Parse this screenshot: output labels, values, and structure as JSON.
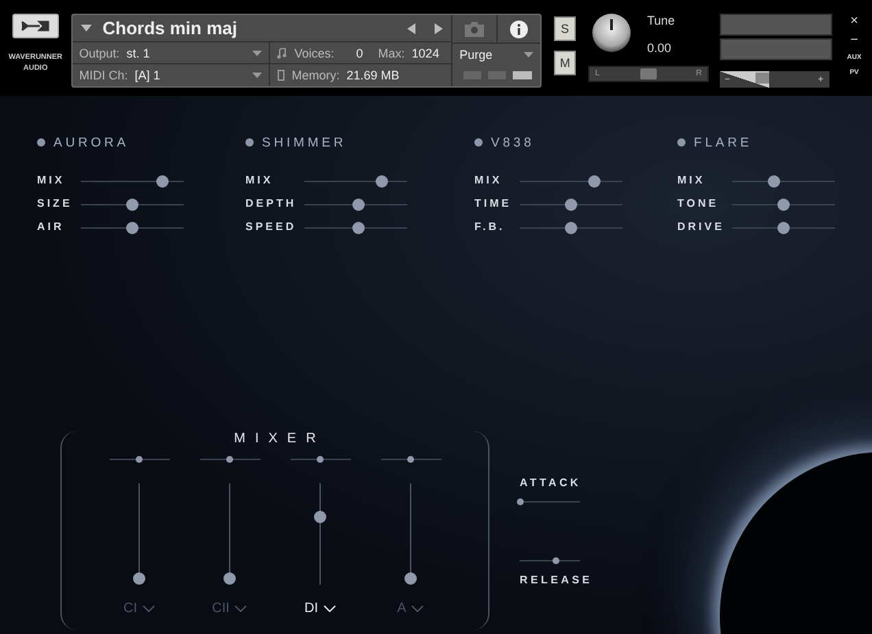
{
  "header": {
    "brand": "WAVERUNNER AUDIO",
    "instrument": {
      "name": "Chords min maj",
      "output_label": "Output:",
      "output": "st. 1",
      "midi_label": "MIDI Ch:",
      "midi": "[A] 1",
      "voices_label": "Voices:",
      "voices": "0",
      "max_label": "Max:",
      "max": "1024",
      "memory_label": "Memory:",
      "memory": "21.69 MB",
      "purge": "Purge"
    },
    "solo": "S",
    "mute": "M",
    "tune_label": "Tune",
    "tune": "0.00",
    "pan": {
      "level": 0.5
    },
    "volume": {
      "level": 0.45
    },
    "pan_left": "L",
    "pan_right": "R",
    "volume_minus": "−",
    "volume_plus": "+",
    "close": "×",
    "minimize": "−",
    "aux": "AUX",
    "pv": "PV"
  },
  "effects": [
    {
      "title": "AURORA",
      "params": [
        {
          "label": "MIX",
          "level": 0.8
        },
        {
          "label": "SIZE",
          "level": 0.5
        },
        {
          "label": "AIR",
          "level": 0.5
        }
      ]
    },
    {
      "title": "SHIMMER",
      "params": [
        {
          "label": "MIX",
          "level": 0.75
        },
        {
          "label": "DEPTH",
          "level": 0.52
        },
        {
          "label": "SPEED",
          "level": 0.52
        }
      ]
    },
    {
      "title": "V838",
      "params": [
        {
          "label": "MIX",
          "level": 0.72
        },
        {
          "label": "TIME",
          "level": 0.5
        },
        {
          "label": "F.B.",
          "level": 0.5
        }
      ]
    },
    {
      "title": "FLARE",
      "params": [
        {
          "label": "MIX",
          "level": 0.4
        },
        {
          "label": "TONE",
          "level": 0.5
        },
        {
          "label": "DRIVE",
          "level": 0.5
        }
      ]
    }
  ],
  "mixer": {
    "title": "MIXER",
    "channels": [
      {
        "label": "CI",
        "selected": false,
        "pan": {
          "level": 0.5
        },
        "fader": {
          "level": 0.0
        }
      },
      {
        "label": "CII",
        "selected": false,
        "pan": {
          "level": 0.5
        },
        "fader": {
          "level": 0.0
        }
      },
      {
        "label": "DI",
        "selected": true,
        "pan": {
          "level": 0.5
        },
        "fader": {
          "level": 0.7
        }
      },
      {
        "label": "A",
        "selected": false,
        "pan": {
          "level": 0.5
        },
        "fader": {
          "level": 0.0
        }
      }
    ]
  },
  "envelope": [
    {
      "label": "ATTACK",
      "level": 0.0,
      "kind": "label-above"
    },
    {
      "label": "RELEASE",
      "level": 0.6,
      "kind": "label-below"
    }
  ]
}
